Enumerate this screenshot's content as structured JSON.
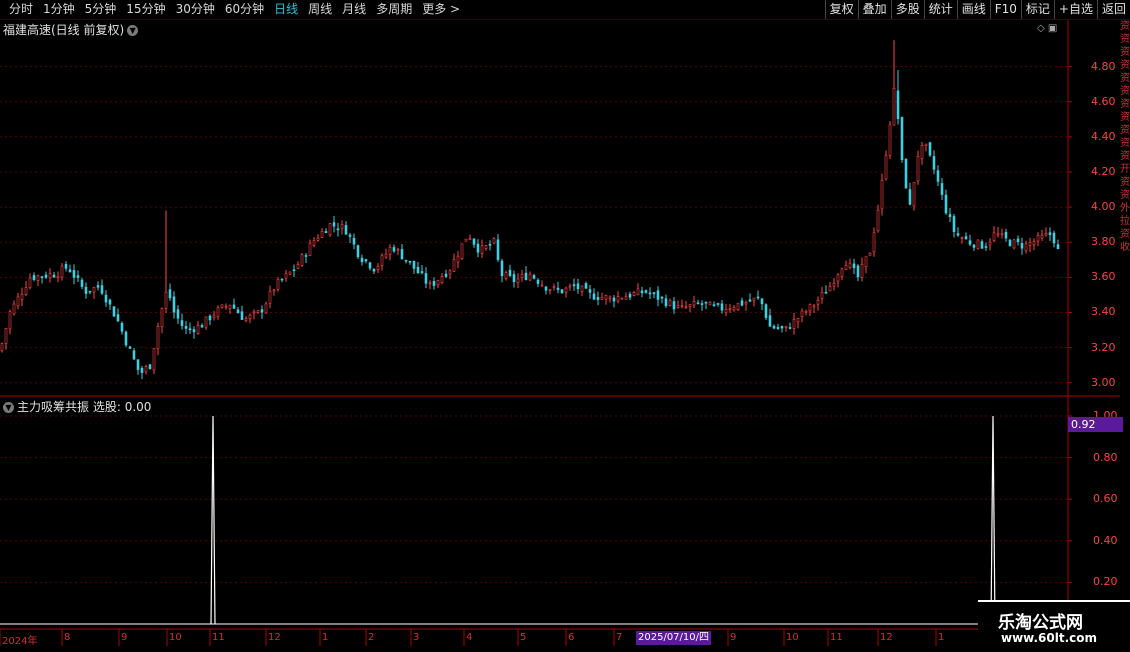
{
  "toolbar": {
    "tabs": [
      "分时",
      "1分钟",
      "5分钟",
      "15分钟",
      "30分钟",
      "60分钟",
      "日线",
      "周线",
      "月线",
      "多周期",
      "更多 >"
    ],
    "active_tab": "日线",
    "right_buttons": [
      "复权",
      "叠加",
      "多股",
      "统计",
      "画线",
      "F10",
      "标记",
      "+自选",
      "返回"
    ]
  },
  "main": {
    "title": "福建高速(日线 前复权)",
    "y_ticks": [
      "4.80",
      "4.60",
      "4.40",
      "4.20",
      "4.00",
      "3.80",
      "3.60",
      "3.40",
      "3.20",
      "3.00"
    ]
  },
  "indicator": {
    "name": "主力吸筹共振",
    "select_label": "选股:",
    "select_value": "0.00",
    "y_ticks": [
      "1.00",
      "0.80",
      "0.60",
      "0.40",
      "0.20"
    ],
    "cursor_value": "0.92"
  },
  "xaxis": {
    "labels": [
      "2024年",
      "8",
      "9",
      "10",
      "11",
      "12",
      "1",
      "2",
      "3",
      "4",
      "5",
      "6",
      "7",
      "9",
      "10",
      "11",
      "12",
      "1"
    ],
    "cursor_date": "2025/07/10/四"
  },
  "watermark": {
    "line1": "乐淘公式网",
    "line2": "www.60lt.com"
  },
  "colors": {
    "up": "#ff4545",
    "down": "#3fd0e0",
    "grid": "#5a0000",
    "axis": "#b00000",
    "accent": "#29c5d8"
  },
  "chart_data": [
    {
      "type": "candlestick",
      "title": "福建高速(日线 前复权)",
      "ylim": [
        3.0,
        4.95
      ],
      "x": [
        "2024-07",
        "2024-08",
        "2024-09",
        "2024-10",
        "2024-11",
        "2024-12",
        "2025-01",
        "2025-02",
        "2025-03",
        "2025-04",
        "2025-05",
        "2025-06",
        "2025-07",
        "2025-08",
        "2025-09",
        "2025-10",
        "2025-11",
        "2025-12",
        "2026-01",
        "2026-02"
      ],
      "close": [
        3.4,
        3.62,
        3.55,
        3.08,
        3.35,
        3.3,
        3.48,
        3.85,
        3.62,
        3.8,
        3.55,
        3.5,
        3.48,
        3.45,
        3.3,
        3.55,
        3.8,
        4.45,
        3.8,
        3.55
      ]
    },
    {
      "type": "line",
      "title": "主力吸筹共振",
      "ylim": [
        0,
        1.0
      ],
      "spikes": [
        {
          "x": "2024-11",
          "value": 1.0
        },
        {
          "x": "2026-01",
          "value": 1.0
        }
      ]
    }
  ]
}
